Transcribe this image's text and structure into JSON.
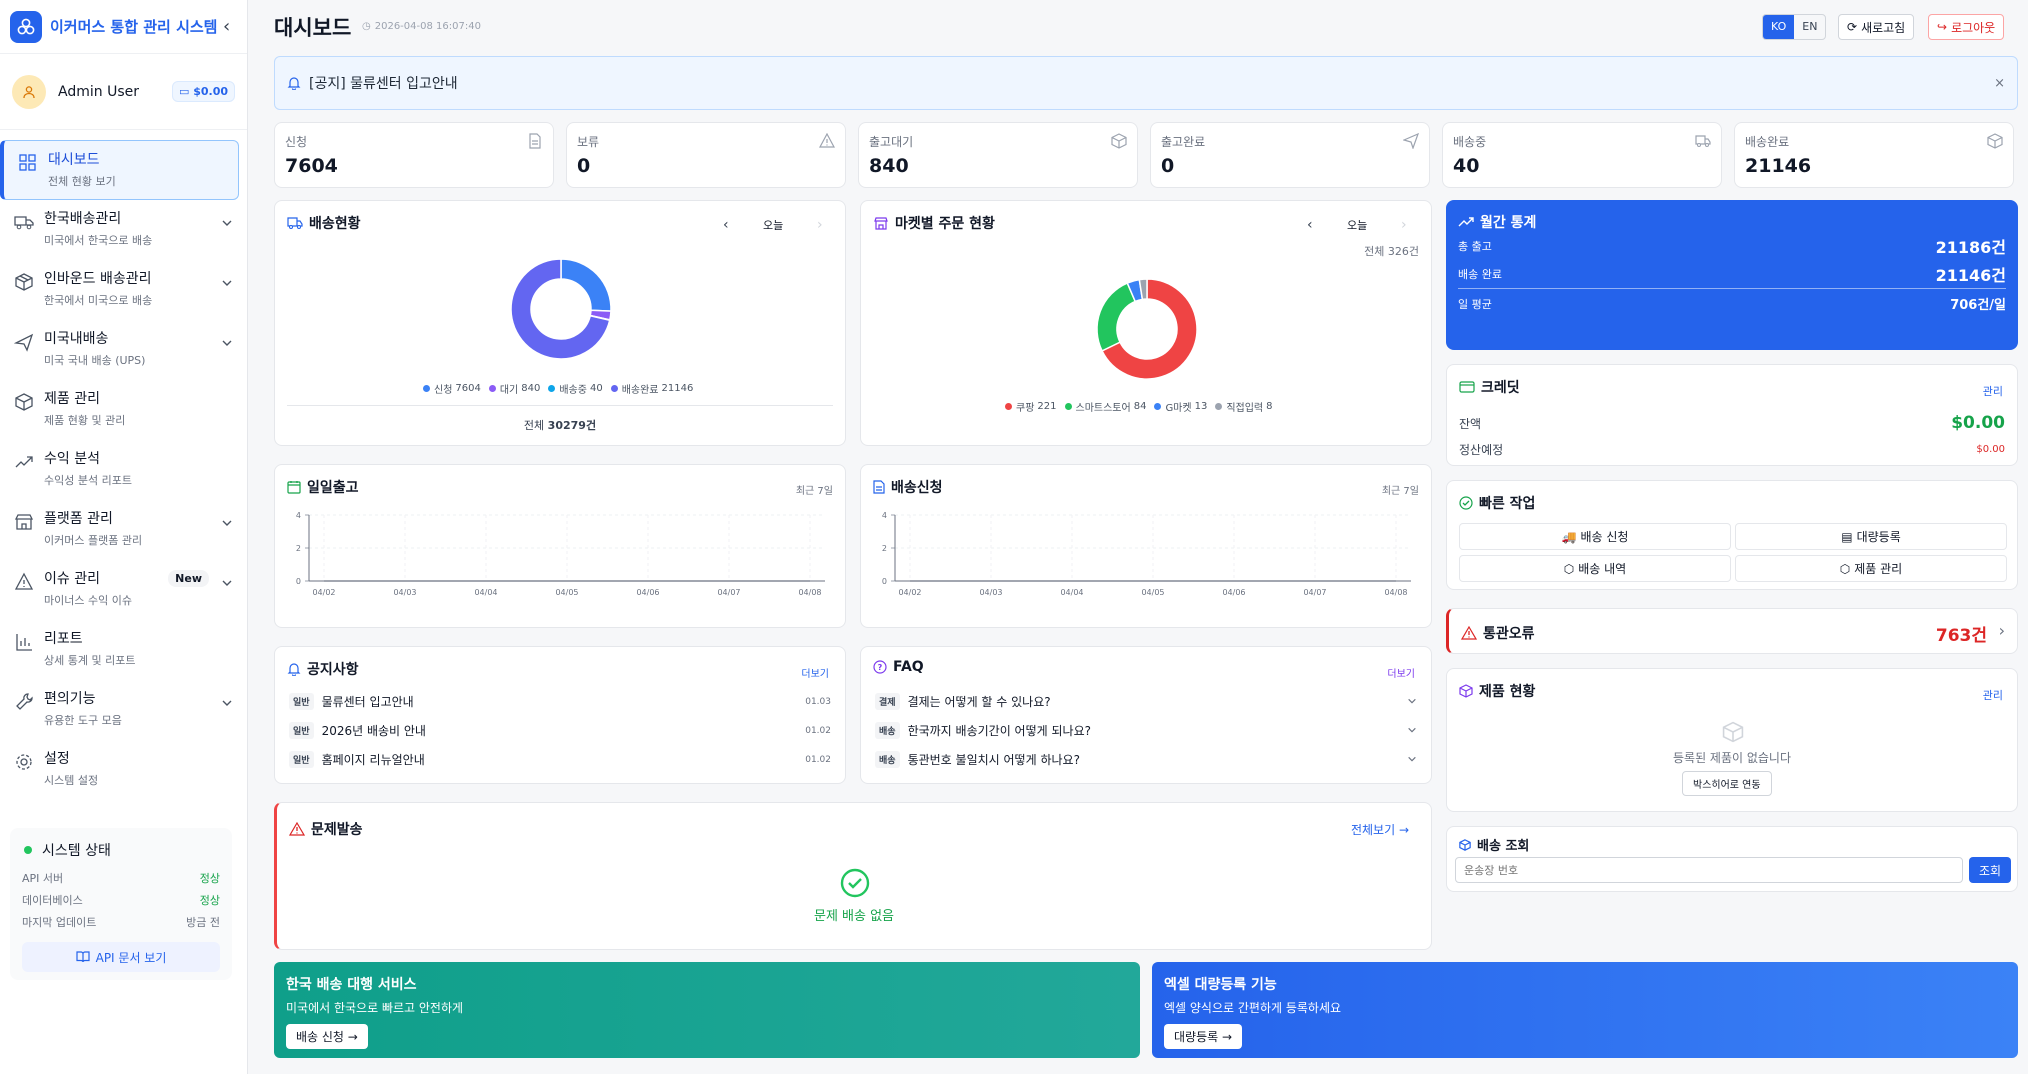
{
  "app": {
    "title": "이커머스 통합 관리 시스템"
  },
  "user": {
    "name": "Admin User",
    "balance": "$0.00"
  },
  "nav": [
    {
      "label": "대시보드",
      "sub": "전체 현황 보기",
      "icon": "dashboard-icon",
      "active": true
    },
    {
      "label": "한국배송관리",
      "sub": "미국에서 한국으로 배송",
      "icon": "truck-icon",
      "chevron": true
    },
    {
      "label": "인바운드 배송관리",
      "sub": "한국에서 미국으로 배송",
      "icon": "package-icon",
      "chevron": true
    },
    {
      "label": "미국내배송",
      "sub": "미국 국내 배송 (UPS)",
      "icon": "plane-icon",
      "chevron": true
    },
    {
      "label": "제품 관리",
      "sub": "제품 현황 및 관리",
      "icon": "box-icon"
    },
    {
      "label": "수익 분석",
      "sub": "수익성 분석 리포트",
      "icon": "trend-icon"
    },
    {
      "label": "플랫폼 관리",
      "sub": "이커머스 플랫폼 관리",
      "icon": "store-icon",
      "chevron": true
    },
    {
      "label": "이슈 관리",
      "sub": "마이너스 수익 이슈",
      "icon": "alert-icon",
      "chevron": true,
      "badge": "New"
    },
    {
      "label": "리포트",
      "sub": "상세 통계 및 리포트",
      "icon": "bar-chart-icon"
    },
    {
      "label": "편의기능",
      "sub": "유용한 도구 모음",
      "icon": "wrench-icon",
      "chevron": true
    },
    {
      "label": "설정",
      "sub": "시스템 설정",
      "icon": "gear-icon"
    }
  ],
  "system": {
    "title": "시스템 상태",
    "rows": [
      {
        "k": "API 서버",
        "v": "정상",
        "ok": true
      },
      {
        "k": "데이터베이스",
        "v": "정상",
        "ok": true
      },
      {
        "k": "마지막 업데이트",
        "v": "방금 전",
        "ok": false
      }
    ],
    "api_doc": "API 문서 보기"
  },
  "header": {
    "title": "대시보드",
    "time": "2026-04-08 16:07:40",
    "lang_ko": "KO",
    "lang_en": "EN",
    "refresh": "새로고침",
    "logout": "로그아웃"
  },
  "notice": {
    "text": "[공지] 물류센터 입고안내",
    "close": "×"
  },
  "stats": [
    {
      "label": "신청",
      "value": "7604",
      "icon": "file-icon"
    },
    {
      "label": "보류",
      "value": "0",
      "icon": "alert-icon"
    },
    {
      "label": "출고대기",
      "value": "840",
      "icon": "cube-icon"
    },
    {
      "label": "출고완료",
      "value": "0",
      "icon": "send-icon"
    },
    {
      "label": "배송중",
      "value": "40",
      "icon": "truck-icon"
    },
    {
      "label": "배송완료",
      "value": "21146",
      "icon": "cube-icon"
    }
  ],
  "shipping": {
    "title": "배송현황",
    "period": "오늘",
    "total_label": "전체",
    "total_value": "30279건",
    "legend": [
      {
        "name": "신청",
        "value": "7604",
        "color": "#3b82f6"
      },
      {
        "name": "대기",
        "value": "840",
        "color": "#8b5cf6"
      },
      {
        "name": "배송중",
        "value": "40",
        "color": "#0ea5e9"
      },
      {
        "name": "배송완료",
        "value": "21146",
        "color": "#6366f1"
      }
    ]
  },
  "market": {
    "title": "마켓별 주문 현황",
    "period": "오늘",
    "total": "전체 326건",
    "legend": [
      {
        "name": "쿠팡",
        "value": "221",
        "color": "#ef4444"
      },
      {
        "name": "스마트스토어",
        "value": "84",
        "color": "#22c55e"
      },
      {
        "name": "G마켓",
        "value": "13",
        "color": "#3b82f6"
      },
      {
        "name": "직접입력",
        "value": "8",
        "color": "#9ca3af"
      }
    ]
  },
  "chart_data": [
    {
      "type": "pie",
      "title": "배송현황",
      "categories": [
        "신청",
        "대기",
        "배송중",
        "배송완료"
      ],
      "values": [
        7604,
        840,
        40,
        21146
      ],
      "colors": [
        "#3b82f6",
        "#8b5cf6",
        "#0ea5e9",
        "#6366f1"
      ]
    },
    {
      "type": "pie",
      "title": "마켓별 주문 현황",
      "categories": [
        "쿠팡",
        "스마트스토어",
        "G마켓",
        "직접입력"
      ],
      "values": [
        221,
        84,
        13,
        8
      ],
      "colors": [
        "#ef4444",
        "#22c55e",
        "#3b82f6",
        "#9ca3af"
      ]
    },
    {
      "type": "line",
      "title": "일일출고",
      "x": [
        "04/02",
        "04/03",
        "04/04",
        "04/05",
        "04/06",
        "04/07",
        "04/08"
      ],
      "values": [
        0,
        0,
        0,
        0,
        0,
        0,
        0
      ],
      "yticks": [
        "0",
        "2",
        "4"
      ],
      "ylim": [
        0,
        4
      ]
    },
    {
      "type": "line",
      "title": "배송신청",
      "x": [
        "04/02",
        "04/03",
        "04/04",
        "04/05",
        "04/06",
        "04/07",
        "04/08"
      ],
      "values": [
        0,
        0,
        0,
        0,
        0,
        0,
        0
      ],
      "yticks": [
        "0",
        "2",
        "4"
      ],
      "ylim": [
        0,
        4
      ]
    }
  ],
  "daily": {
    "title": "일일출고",
    "period": "최근 7일"
  },
  "requests": {
    "title": "배송신청",
    "period": "최근 7일"
  },
  "notices": {
    "title": "공지사항",
    "more": "더보기",
    "items": [
      {
        "tag": "일반",
        "text": "물류센터 입고안내",
        "date": "01.03"
      },
      {
        "tag": "일반",
        "text": "2026년 배송비 안내",
        "date": "01.02"
      },
      {
        "tag": "일반",
        "text": "홈페이지 리뉴얼안내",
        "date": "01.02"
      }
    ]
  },
  "faq": {
    "title": "FAQ",
    "more": "더보기",
    "items": [
      {
        "tag": "결제",
        "text": "결제는 어떻게 할 수 있나요?"
      },
      {
        "tag": "배송",
        "text": "한국까지 배송기간이 어떻게 되나요?"
      },
      {
        "tag": "배송",
        "text": "통관번호 불일치시 어떻게 하나요?"
      }
    ]
  },
  "problem": {
    "title": "문제발송",
    "link": "전체보기 →",
    "empty": "문제 배송 없음"
  },
  "monthly": {
    "title": "월간 통계",
    "rows": [
      {
        "k": "총 출고",
        "v": "21186건"
      },
      {
        "k": "배송 완료",
        "v": "21146건"
      },
      {
        "k": "일 평균",
        "v": "706건/일"
      }
    ]
  },
  "credit": {
    "title": "크레딧",
    "manage": "관리",
    "balance_label": "잔액",
    "balance": "$0.00",
    "pending_label": "정산예정",
    "pending": "$0.00"
  },
  "quick": {
    "title": "빠른 작업",
    "buttons": [
      "배송 신청",
      "대량등록",
      "배송 내역",
      "제품 관리"
    ]
  },
  "customs": {
    "title": "통관오류",
    "count": "763건"
  },
  "products": {
    "title": "제품 현황",
    "manage": "관리",
    "empty": "등록된 제품이 없습니다",
    "link": "박스히어로 연동"
  },
  "track": {
    "title": "배송 조회",
    "placeholder": "운송장 번호",
    "button": "조회"
  },
  "banners": [
    {
      "title": "한국 배송 대행 서비스",
      "sub": "미국에서 한국으로 빠르고 안전하게",
      "button": "배송 신청 →"
    },
    {
      "title": "엑셀 대량등록 기능",
      "sub": "엑셀 양식으로 간편하게 등록하세요",
      "button": "대량등록 →"
    }
  ],
  "colors": {
    "primary": "#2563eb",
    "danger": "#dc2626",
    "success": "#16a34a"
  }
}
